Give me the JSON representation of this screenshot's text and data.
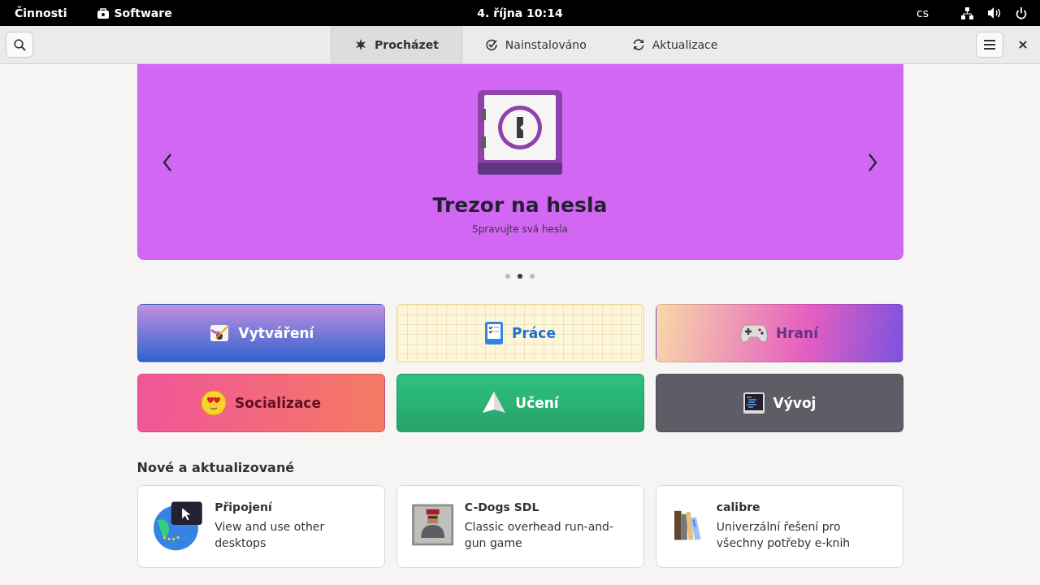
{
  "top_bar": {
    "activities": "Činnosti",
    "app_name": "Software",
    "clock": "4. října  10:14",
    "language": "cs"
  },
  "header": {
    "tabs": [
      {
        "label": "Procházet",
        "selected": true,
        "kind": "browse"
      },
      {
        "label": "Nainstalováno",
        "selected": false,
        "kind": "installed"
      },
      {
        "label": "Aktualizace",
        "selected": false,
        "kind": "updates"
      }
    ]
  },
  "featured": {
    "title": "Trezor na hesla",
    "subtitle": "Spravujte svá hesla",
    "dots": [
      {
        "selected": false
      },
      {
        "selected": true
      },
      {
        "selected": false
      }
    ]
  },
  "categories": [
    {
      "label": "Vytváření",
      "kind": "create"
    },
    {
      "label": "Práce",
      "kind": "work"
    },
    {
      "label": "Hraní",
      "kind": "play"
    },
    {
      "label": "Socializace",
      "kind": "social"
    },
    {
      "label": "Učení",
      "kind": "learn"
    },
    {
      "label": "Vývoj",
      "kind": "develop"
    }
  ],
  "new_updated": {
    "heading": "Nové a aktualizované",
    "apps": [
      {
        "name": "Připojení",
        "description": "View and use other desktops",
        "kind": "connections"
      },
      {
        "name": "C-Dogs SDL",
        "description": "Classic overhead run-and-gun game",
        "kind": "cdogs"
      },
      {
        "name": "calibre",
        "description": "Univerzální řešení pro všechny potřeby e-knih",
        "kind": "calibre"
      }
    ]
  }
}
